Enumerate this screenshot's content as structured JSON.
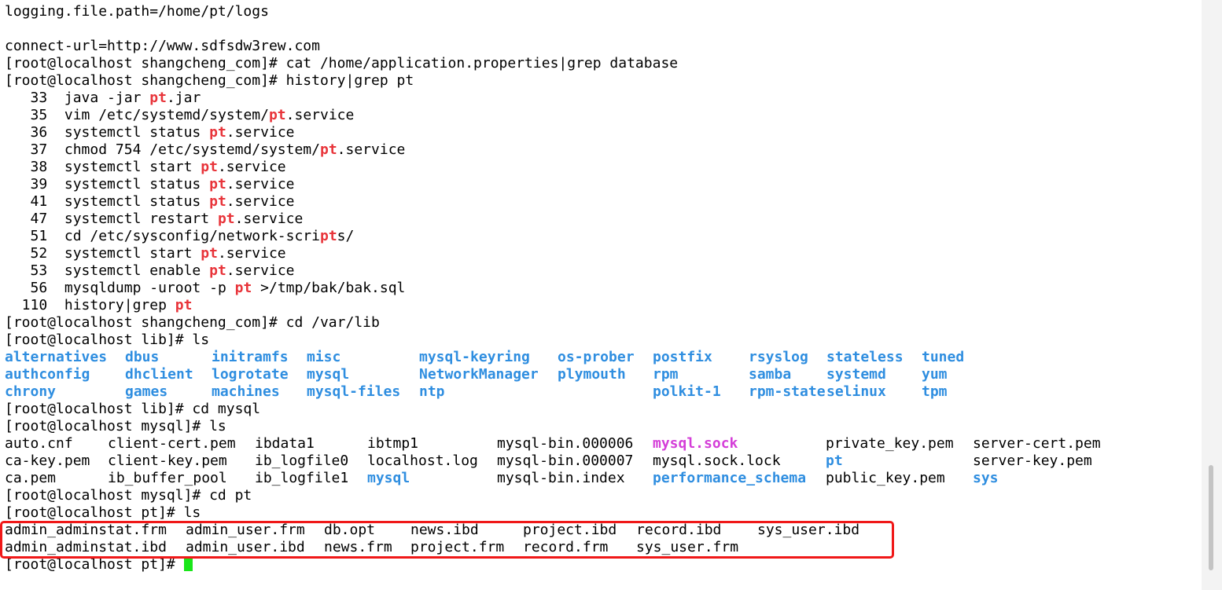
{
  "prefix_lines": [
    "logging.file.path=/home/pt/logs",
    "",
    "connect-url=http://www.sdfsdw3rew.com",
    "[root@localhost shangcheng_com]# cat /home/application.properties|grep database",
    "[root@localhost shangcheng_com]# history|grep pt"
  ],
  "history": [
    {
      "num": "   33",
      "before": "java -jar ",
      "hl": "pt",
      "after": ".jar"
    },
    {
      "num": "   35",
      "before": "vim /etc/systemd/system/",
      "hl": "pt",
      "after": ".service"
    },
    {
      "num": "   36",
      "before": "systemctl status ",
      "hl": "pt",
      "after": ".service"
    },
    {
      "num": "   37",
      "before": "chmod 754 /etc/systemd/system/",
      "hl": "pt",
      "after": ".service"
    },
    {
      "num": "   38",
      "before": "systemctl start ",
      "hl": "pt",
      "after": ".service"
    },
    {
      "num": "   39",
      "before": "systemctl status ",
      "hl": "pt",
      "after": ".service"
    },
    {
      "num": "   41",
      "before": "systemctl status ",
      "hl": "pt",
      "after": ".service"
    },
    {
      "num": "   47",
      "before": "systemctl restart ",
      "hl": "pt",
      "after": ".service"
    },
    {
      "num": "   51",
      "before": "cd /etc/sysconfig/network-scri",
      "hl": "pt",
      "after": "s/"
    },
    {
      "num": "   52",
      "before": "systemctl start ",
      "hl": "pt",
      "after": ".service"
    },
    {
      "num": "   53",
      "before": "systemctl enable ",
      "hl": "pt",
      "after": ".service"
    },
    {
      "num": "   56",
      "before": "mysqldump -uroot -p ",
      "hl": "pt",
      "after": " >/tmp/bak/bak.sql"
    },
    {
      "num": "  110",
      "before": "history|grep ",
      "hl": "pt",
      "after": ""
    }
  ],
  "cmd_cd_varlib": "[root@localhost shangcheng_com]# cd /var/lib",
  "cmd_ls_lib": "[root@localhost lib]# ls",
  "varlib_listing": [
    [
      "alternatives",
      "dbus",
      "initramfs",
      "misc",
      "mysql-keyring",
      "os-prober",
      "postfix",
      "rsyslog",
      "stateless",
      "tuned"
    ],
    [
      "authconfig",
      "dhclient",
      "logrotate",
      "mysql",
      "NetworkManager",
      "plymouth",
      "rpm",
      "samba",
      "systemd",
      "yum"
    ],
    [
      "chrony",
      "games",
      "machines",
      "mysql-files",
      "ntp",
      "",
      "polkit-1",
      "rpm-state",
      "selinux",
      "tpm"
    ]
  ],
  "cmd_cd_mysql": "[root@localhost lib]# cd mysql",
  "cmd_ls_mysql": "[root@localhost mysql]# ls",
  "mysql_listing": [
    [
      {
        "t": "auto.cnf",
        "k": "f"
      },
      {
        "t": "client-cert.pem",
        "k": "f"
      },
      {
        "t": "ibdata1",
        "k": "f"
      },
      {
        "t": "ibtmp1",
        "k": "f"
      },
      {
        "t": "mysql-bin.000006",
        "k": "f"
      },
      {
        "t": "mysql.sock",
        "k": "s"
      },
      {
        "t": "private_key.pem",
        "k": "f"
      },
      {
        "t": "server-cert.pem",
        "k": "f"
      }
    ],
    [
      {
        "t": "ca-key.pem",
        "k": "f"
      },
      {
        "t": "client-key.pem",
        "k": "f"
      },
      {
        "t": "ib_logfile0",
        "k": "f"
      },
      {
        "t": "localhost.log",
        "k": "f"
      },
      {
        "t": "mysql-bin.000007",
        "k": "f"
      },
      {
        "t": "mysql.sock.lock",
        "k": "f"
      },
      {
        "t": "pt",
        "k": "d"
      },
      {
        "t": "server-key.pem",
        "k": "f"
      }
    ],
    [
      {
        "t": "ca.pem",
        "k": "f"
      },
      {
        "t": "ib_buffer_pool",
        "k": "f"
      },
      {
        "t": "ib_logfile1",
        "k": "f"
      },
      {
        "t": "mysql",
        "k": "d"
      },
      {
        "t": "mysql-bin.index",
        "k": "f"
      },
      {
        "t": "performance_schema",
        "k": "d"
      },
      {
        "t": "public_key.pem",
        "k": "f"
      },
      {
        "t": "sys",
        "k": "d"
      }
    ]
  ],
  "cmd_cd_pt": "[root@localhost mysql]# cd pt",
  "cmd_ls_pt": "[root@localhost pt]# ls",
  "pt_listing": [
    [
      "admin_adminstat.frm",
      "admin_user.frm",
      "db.opt",
      "news.ibd",
      "project.ibd",
      "record.ibd",
      "sys_user.ibd"
    ],
    [
      "admin_adminstat.ibd",
      "admin_user.ibd",
      "news.frm",
      "project.frm",
      "record.frm",
      "sys_user.frm",
      ""
    ]
  ],
  "final_prompt": "[root@localhost pt]# ",
  "colors": {
    "highlight": "#e8343a",
    "directory": "#2f8ee0",
    "socket": "#d43ed8",
    "cursor": "#19e619",
    "annotation_box": "#f01818"
  }
}
